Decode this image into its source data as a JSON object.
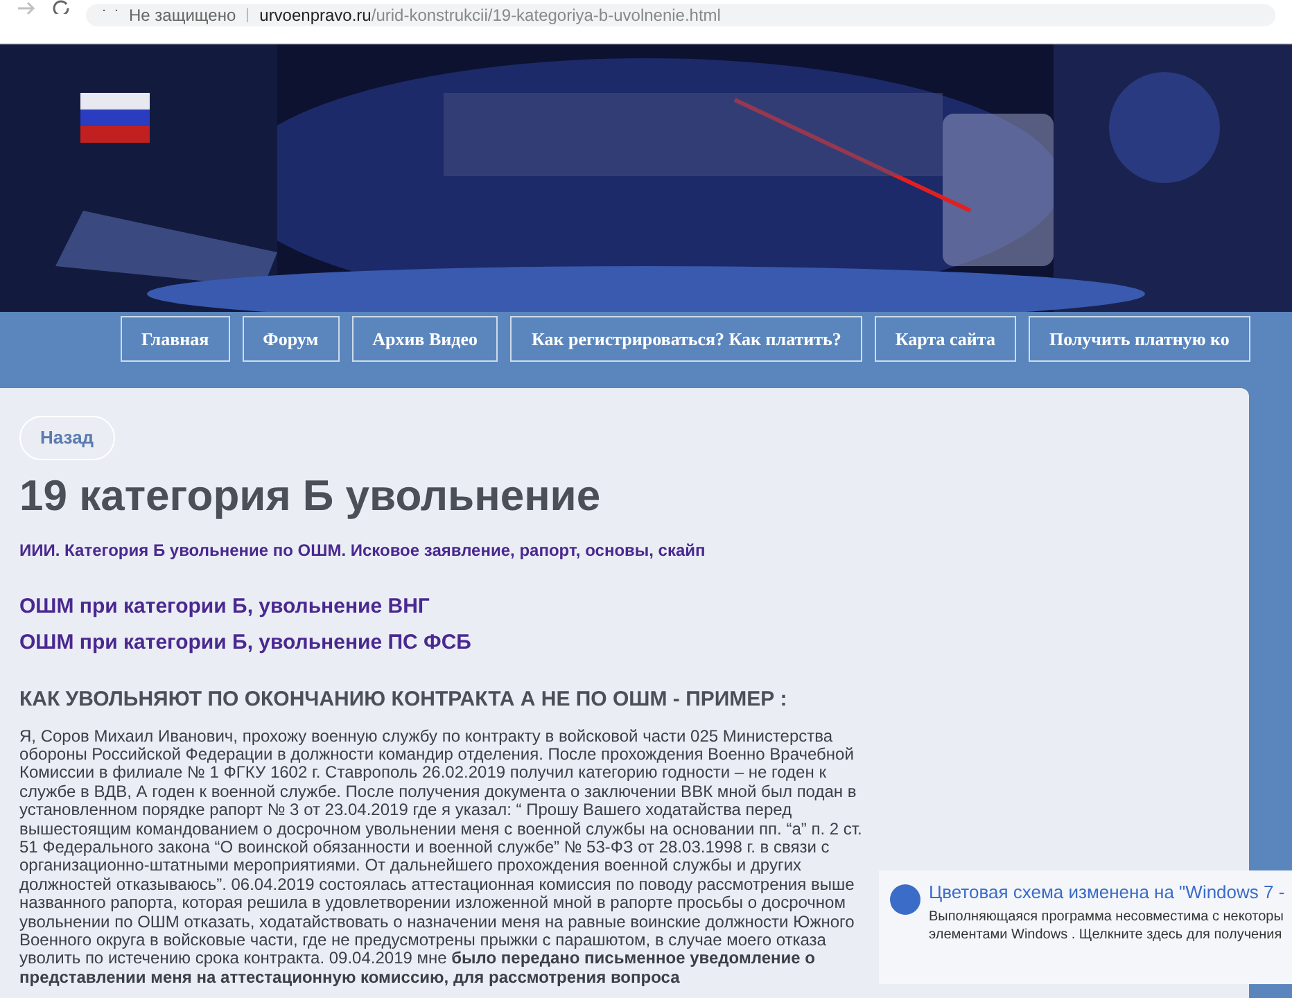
{
  "browser": {
    "security": "Не защищено",
    "url_domain": "urvoenpravo.ru",
    "url_path": "/urid-konstrukcii/19-kategoriya-b-uvolnenie.html"
  },
  "nav": [
    {
      "label": "Главная"
    },
    {
      "label": "Форум"
    },
    {
      "label": "Архив Видео"
    },
    {
      "label": "Как регистрироваться? Как платить?"
    },
    {
      "label": "Карта сайта"
    },
    {
      "label": "Получить платную ко"
    }
  ],
  "back_button": "Назад",
  "title": "19 категория Б увольнение",
  "subtitle": "ИИИ. Категория Б увольнение по ОШМ. Исковое заявление, рапорт, основы, скайп",
  "links": [
    "ОШМ при категории Б, увольнение ВНГ",
    "ОШМ при категории Б, увольнение ПС ФСБ"
  ],
  "section_heading": "КАК УВОЛЬНЯЮТ ПО ОКОНЧАНИЮ КОНТРАКТА А НЕ ПО ОШМ - ПРИМЕР :",
  "paragraph": "Я, Соров Михаил Иванович, прохожу военную службу по контракту в войсковой части 025 Министерства обороны Российской Федерации в должности командир отделения. После прохождения Военно Врачебной Комиссии в филиале № 1 ФГКУ 1602 г. Ставрополь 26.02.2019 получил категорию годности – не годен к службе в ВДВ, А годен к военной службе. После получения документа о заключении ВВК мной был подан в установленном порядке рапорт № 3 от 23.04.2019 где я указал: “ Прошу Вашего ходатайства перед вышестоящим командованием о досрочном увольнении меня с военной службы на основании пп. “а” п. 2 ст. 51 Федерального закона “О воинской обязанности и военной службе” № 53-ФЗ от 28.03.1998 г. в связи с организационно-штатными мероприятиями. От дальнейшего прохождения военной службы и других должностей отказываюсь”. 06.04.2019 состоялась аттестационная комиссия по поводу рассмотрения выше названного рапорта, которая решила в удовлетворении изложенной мной в рапорте просьбы о досрочном увольнении по ОШМ отказать, ходатайствовать о назначении меня на равные воинские должности Южного Военного округа в войсковые части, где не предусмотрены прыжки с парашютом, в случае моего отказа уволить по истечению срока контракта. 09.04.2019 мне **было передано письменное уведомление о представлении меня на аттестационную комиссию, для рассмотрения вопроса**",
  "notification": {
    "title": "Цветовая схема изменена на \"Windows 7 -",
    "line_1": "Выполняющаяся программа несовместима с некоторы",
    "line_2": "элементами Windows . Щелкните здесь для получения"
  }
}
